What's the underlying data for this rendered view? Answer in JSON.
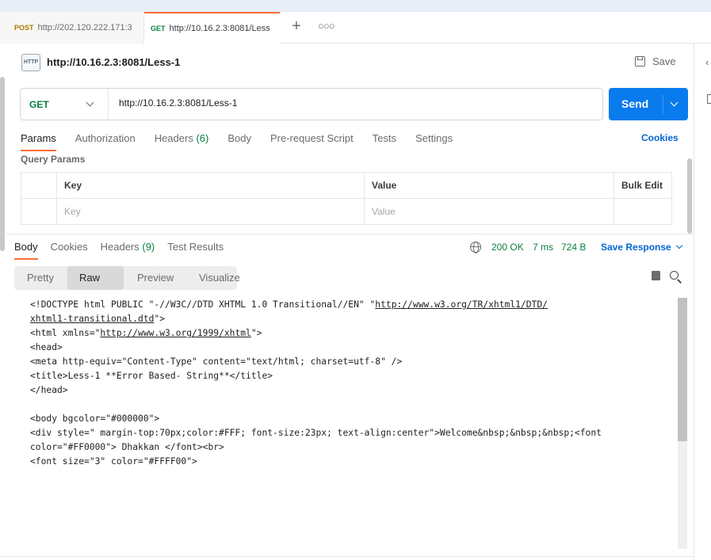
{
  "tabs": [
    {
      "method": "POST",
      "url": "http://202.120.222.171:3"
    },
    {
      "method": "GET",
      "url": "http://10.16.2.3:8081/Less"
    }
  ],
  "request": {
    "title": "http://10.16.2.3:8081/Less-1",
    "save_label": "Save",
    "method": "GET",
    "url": "http://10.16.2.3:8081/Less-1",
    "send_label": "Send",
    "icon_text": "HTTP"
  },
  "request_tabs": [
    {
      "label": "Params",
      "count": ""
    },
    {
      "label": "Authorization",
      "count": ""
    },
    {
      "label": "Headers",
      "count": "(6)"
    },
    {
      "label": "Body",
      "count": ""
    },
    {
      "label": "Pre-request Script",
      "count": ""
    },
    {
      "label": "Tests",
      "count": ""
    },
    {
      "label": "Settings",
      "count": ""
    }
  ],
  "cookies_label": "Cookies",
  "query_params": {
    "title": "Query Params",
    "headers": {
      "key": "Key",
      "value": "Value",
      "bulk": "Bulk Edit"
    },
    "placeholders": {
      "key": "Key",
      "value": "Value"
    }
  },
  "response_tabs": [
    {
      "label": "Body",
      "count": ""
    },
    {
      "label": "Cookies",
      "count": ""
    },
    {
      "label": "Headers",
      "count": "(9)"
    },
    {
      "label": "Test Results",
      "count": ""
    }
  ],
  "response_status": {
    "code": "200 OK",
    "time": "7 ms",
    "size": "724 B",
    "save_response": "Save Response"
  },
  "format_tabs": [
    "Pretty",
    "Raw",
    "Preview",
    "Visualize"
  ],
  "code_lines": [
    {
      "pre": "<!DOCTYPE html PUBLIC \"-//W3C//DTD XHTML 1.0 Transitional//EN\" \"",
      "link": "http://www.w3.org/TR/xhtml1/DTD/",
      "post": ""
    },
    {
      "pre": "",
      "link": "xhtml1-transitional.dtd",
      "post": "\">"
    },
    {
      "pre": "<html xmlns=\"",
      "link": "http://www.w3.org/1999/xhtml",
      "post": "\">"
    },
    {
      "pre": "<head>",
      "link": "",
      "post": ""
    },
    {
      "pre": "<meta http-equiv=\"Content-Type\" content=\"text/html; charset=utf-8\" />",
      "link": "",
      "post": ""
    },
    {
      "pre": "<title>Less-1 **Error Based- String**</title>",
      "link": "",
      "post": ""
    },
    {
      "pre": "</head>",
      "link": "",
      "post": ""
    },
    {
      "pre": "",
      "link": "",
      "post": ""
    },
    {
      "pre": "<body bgcolor=\"#000000\">",
      "link": "",
      "post": ""
    },
    {
      "pre": "<div style=\" margin-top:70px;color:#FFF; font-size:23px; text-align:center\">Welcome&nbsp;&nbsp;&nbsp;<font",
      "link": "",
      "post": ""
    },
    {
      "pre": "color=\"#FF0000\"> Dhakkan </font><br>",
      "link": "",
      "post": ""
    },
    {
      "pre": "<font size=\"3\" color=\"#FFFF00\">",
      "link": "",
      "post": ""
    }
  ],
  "colors": {
    "accent": "#ff6c37",
    "send": "#097bed",
    "link": "#0265d2",
    "success": "#0a7f3f",
    "post": "#ad7a03"
  }
}
